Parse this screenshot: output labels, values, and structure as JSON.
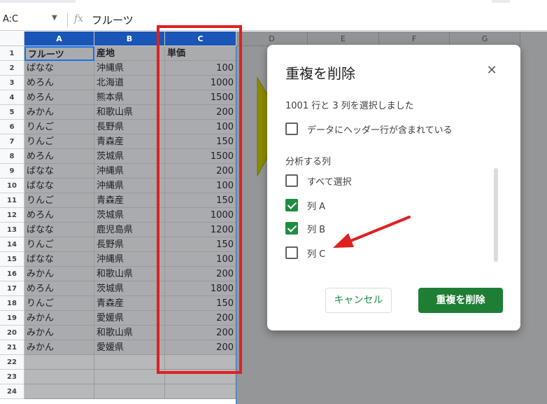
{
  "formula_bar": {
    "name_box": "A:C",
    "dropdown_icon": "▼",
    "fx_label": "fx",
    "formula": "フルーツ"
  },
  "columns": [
    "A",
    "B",
    "C",
    "D",
    "E",
    "F",
    "G"
  ],
  "row_numbers": [
    "1",
    "2",
    "3",
    "4",
    "5",
    "6",
    "7",
    "8",
    "9",
    "10",
    "11",
    "12",
    "13",
    "14",
    "15",
    "16",
    "17",
    "18",
    "19",
    "20",
    "21",
    "22",
    "23",
    "24"
  ],
  "sheet": {
    "header": [
      "フルーツ",
      "産地",
      "単価"
    ],
    "rows": [
      [
        "ばなな",
        "沖縄県",
        "100"
      ],
      [
        "めろん",
        "北海道",
        "1000"
      ],
      [
        "めろん",
        "熊本県",
        "1500"
      ],
      [
        "みかん",
        "和歌山県",
        "200"
      ],
      [
        "りんご",
        "長野県",
        "100"
      ],
      [
        "りんご",
        "青森産",
        "150"
      ],
      [
        "めろん",
        "茨城県",
        "1500"
      ],
      [
        "ばなな",
        "沖縄県",
        "200"
      ],
      [
        "ばなな",
        "沖縄県",
        "100"
      ],
      [
        "りんご",
        "青森産",
        "150"
      ],
      [
        "めろん",
        "茨城県",
        "1000"
      ],
      [
        "ばなな",
        "鹿児島県",
        "1200"
      ],
      [
        "りんご",
        "長野県",
        "150"
      ],
      [
        "ばなな",
        "沖縄県",
        "100"
      ],
      [
        "みかん",
        "和歌山県",
        "200"
      ],
      [
        "めろん",
        "茨城県",
        "1800"
      ],
      [
        "りんご",
        "青森産",
        "150"
      ],
      [
        "みかん",
        "愛媛県",
        "200"
      ],
      [
        "みかん",
        "和歌山県",
        "200"
      ],
      [
        "みかん",
        "愛媛県",
        "200"
      ]
    ]
  },
  "dialog": {
    "title": "重複を削除",
    "close_icon": "✕",
    "selection_info": "1001 行と 3 列を選択しました",
    "header_checkbox_label": "データにヘッダー行が含まれている",
    "section_title": "分析する列",
    "options": [
      {
        "label": "すべて選択",
        "checked": false
      },
      {
        "label": "列 A",
        "checked": true
      },
      {
        "label": "列 B",
        "checked": true
      },
      {
        "label": "列 C",
        "checked": false
      }
    ],
    "cancel_label": "キャンセル",
    "remove_label": "重複を削除"
  },
  "colors": {
    "accent_green": "#1e8e3e",
    "annotation_red": "#e02020",
    "selected_header": "#1a56b8"
  }
}
